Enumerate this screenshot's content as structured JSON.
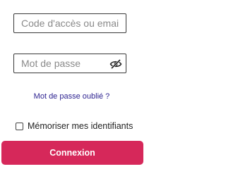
{
  "login": {
    "placeholder": "Code d'accès ou email",
    "value": ""
  },
  "password": {
    "placeholder": "Mot de passe",
    "value": "",
    "toggle_icon": "eye-slash-icon"
  },
  "forgot_password": {
    "label": "Mot de passe oublié ?"
  },
  "remember": {
    "label": "Mémoriser mes identifiants",
    "checked": false
  },
  "submit": {
    "label": "Connexion"
  },
  "colors": {
    "accent": "#d6285a",
    "link": "#2a1f8f"
  }
}
